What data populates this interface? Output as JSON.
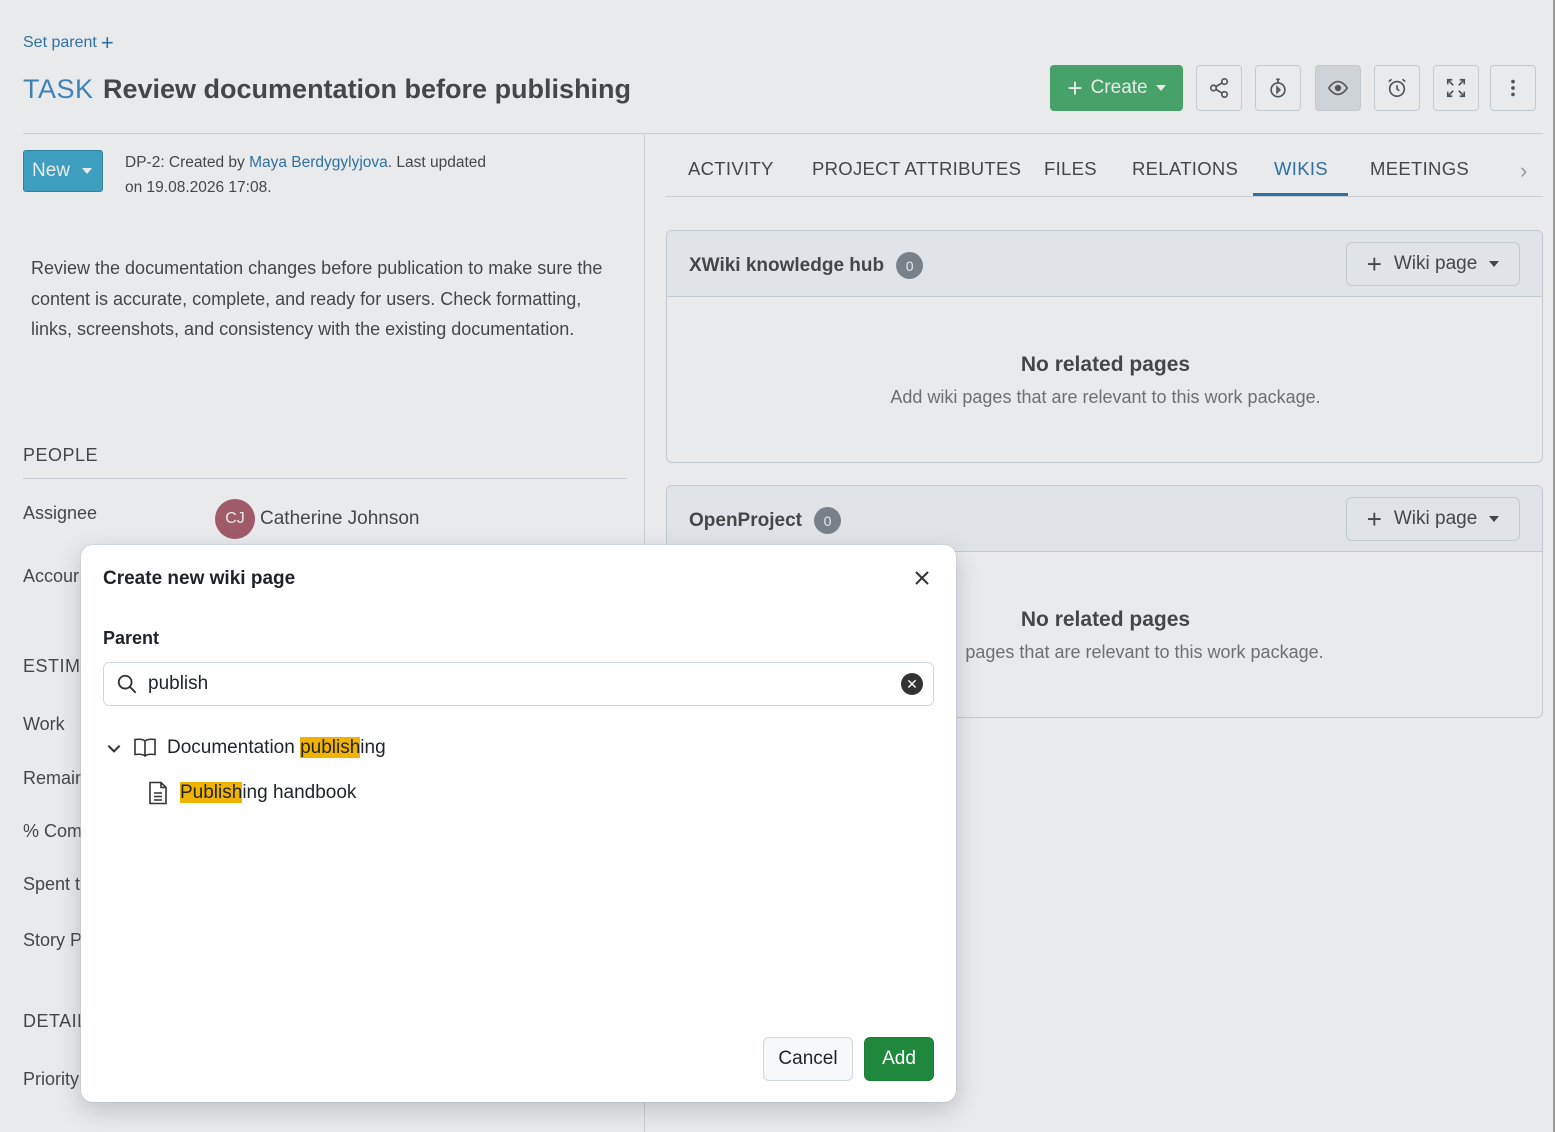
{
  "header": {
    "set_parent": "Set parent",
    "type": "TASK",
    "subject": "Review documentation before publishing",
    "create_label": "Create",
    "colors": {
      "create": "#35a55a",
      "type": "#2e7db8"
    }
  },
  "toolbar_icons": [
    "share-icon",
    "stopwatch-icon",
    "eye-icon",
    "alarm-clock-icon",
    "fullscreen-icon",
    "more-vertical-icon"
  ],
  "left": {
    "status": "New",
    "meta_prefix": "DP-2: Created by ",
    "author": "Maya Berdygylyjova",
    "meta_suffix": ". Last updated",
    "meta_line2": "on 19.08.2026 17:08.",
    "description": "Review the documentation changes before publication to make sure the content is accurate, complete, and ready for users. Check formatting, links, screenshots, and consistency with the existing documentation.",
    "people_title": "PEOPLE",
    "assignee_label": "Assignee",
    "assignee_initials": "CJ",
    "assignee_name": "Catherine Johnson",
    "accountable_label": "Accour",
    "estimates_title": "ESTIMA",
    "work_label": "Work",
    "remaining_label": "Remain",
    "complete_label": "% Com",
    "spent_label": "Spent t",
    "story_label": "Story P",
    "details_title": "DETAIL",
    "priority_label": "Priority"
  },
  "tabs": [
    "ACTIVITY",
    "PROJECT ATTRIBUTES",
    "FILES",
    "RELATIONS",
    "WIKIS",
    "MEETINGS"
  ],
  "active_tab": "WIKIS",
  "wikis": [
    {
      "title": "XWiki knowledge hub",
      "count": "0",
      "button": "Wiki page",
      "empty_title": "No related pages",
      "empty_sub": "Add wiki pages that are relevant to this work package."
    },
    {
      "title": "OpenProject",
      "count": "0",
      "button": "Wiki page",
      "empty_title": "No related pages",
      "empty_sub": "pages that are relevant to this work package."
    }
  ],
  "dialog": {
    "title": "Create new wiki page",
    "parent_label": "Parent",
    "search_value": "publish",
    "tree": [
      {
        "pre": "Documentation ",
        "match": "publish",
        "post": "ing",
        "icon": "book-icon"
      },
      {
        "pre": "",
        "match": "Publish",
        "post": "ing handbook",
        "icon": "document-icon"
      }
    ],
    "cancel": "Cancel",
    "add": "Add"
  }
}
